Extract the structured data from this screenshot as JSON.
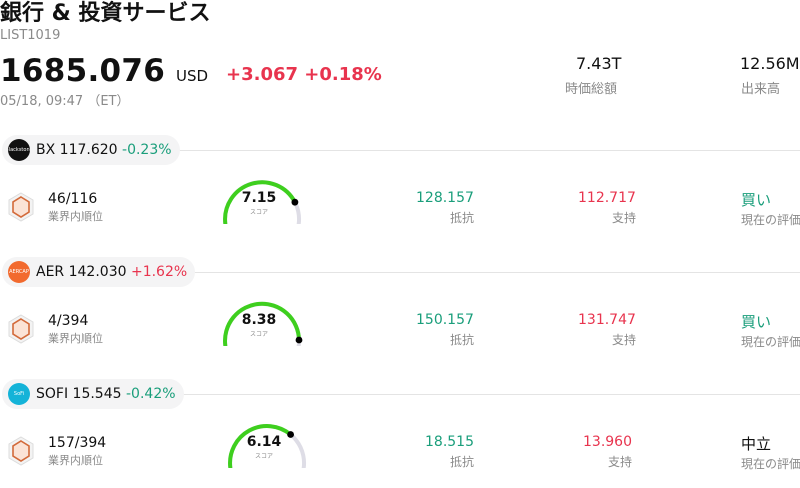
{
  "header": {
    "title": "銀行 & 投資サービス",
    "code": "LIST1019",
    "price": "1685.076",
    "currency": "USD",
    "change": "+3.067 +0.18%",
    "time": "05/18, 09:47 （ET）",
    "stats": [
      {
        "value": "7.43T",
        "label": "時価総額"
      },
      {
        "value": "12.56M",
        "label": "出来高"
      }
    ]
  },
  "colors": {
    "up": "#e8344e",
    "down": "#1a9e7b",
    "gauge": "#3ecf1e"
  },
  "stocks": [
    {
      "ticker": "BX",
      "price": "117.620",
      "change": "-0.23%",
      "logo_text": "Blackstone",
      "rank": "46/116",
      "rank_label": "業界内順位",
      "score": "7.15",
      "score_fraction": 0.72,
      "score_label": "スコア",
      "resistance": "128.157",
      "resistance_label": "抵抗",
      "support": "112.717",
      "support_label": "支持",
      "rating": "買い",
      "rating_label": "現在の評価"
    },
    {
      "ticker": "AER",
      "price": "142.030",
      "change": "+1.62%",
      "logo_text": "AERCAP",
      "rank": "4/394",
      "rank_label": "業界内順位",
      "score": "8.38",
      "score_fraction": 0.84,
      "score_label": "スコア",
      "resistance": "150.157",
      "resistance_label": "抵抗",
      "support": "131.747",
      "support_label": "支持",
      "rating": "買い",
      "rating_label": "現在の評価"
    },
    {
      "ticker": "SOFI",
      "price": "15.545",
      "change": "-0.42%",
      "logo_text": "SoFi",
      "rank": "157/394",
      "rank_label": "業界内順位",
      "score": "6.14",
      "score_fraction": 0.61,
      "score_label": "スコア",
      "resistance": "18.515",
      "resistance_label": "抵抗",
      "support": "13.960",
      "support_label": "支持",
      "rating": "中立",
      "rating_label": "現在の評価"
    }
  ]
}
